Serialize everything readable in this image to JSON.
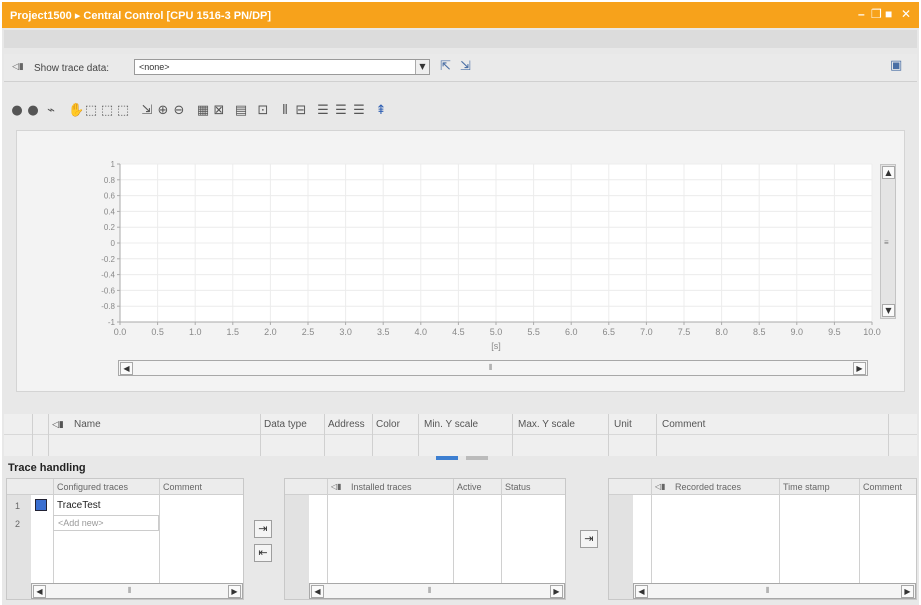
{
  "window": {
    "title": "Project1500 ▸ Central Control [CPU 1516-3 PN/DP]",
    "controls": [
      "–",
      "❐",
      "■",
      "✕"
    ]
  },
  "trace_bar": {
    "label": "Show trace data:",
    "value": "<none>"
  },
  "toolbar": {
    "icons": [
      "play-icon",
      "stop-icon",
      "signal-icon",
      "hand-icon",
      "zoom-box-icon",
      "zoom-x-icon",
      "zoom-y-icon",
      "zoom-fit-icon",
      "zoom-in-icon",
      "zoom-out-icon",
      "export-icon",
      "measure-icon",
      "signal-table-icon",
      "legend-icon",
      "cursor-icon",
      "vertical-cursor-icon",
      "list-icon",
      "align-left-icon",
      "align-right-icon",
      "highlight-icon"
    ]
  },
  "chart_data": {
    "type": "line",
    "title": "",
    "xlabel": "[s]",
    "ylabel": "",
    "xlim": [
      0,
      10
    ],
    "ylim": [
      -1,
      1
    ],
    "x_ticks": [
      "0.0",
      "0.5",
      "1.0",
      "1.5",
      "2.0",
      "2.5",
      "3.0",
      "3.5",
      "4.0",
      "4.5",
      "5.0",
      "5.5",
      "6.0",
      "6.5",
      "7.0",
      "7.5",
      "8.0",
      "8.5",
      "9.0",
      "9.5",
      "10.0"
    ],
    "y_ticks": [
      "1",
      "0.8",
      "0.6",
      "0.4",
      "0.2",
      "0",
      "-0.2",
      "-0.4",
      "-0.6",
      "-0.8",
      "-1"
    ],
    "series": [],
    "grid": true
  },
  "signal_table": {
    "columns": [
      "Name",
      "Data type",
      "Address",
      "Color",
      "Min. Y scale",
      "Max. Y scale",
      "Unit",
      "Comment"
    ]
  },
  "trace_handling": {
    "title": "Trace handling",
    "configured": {
      "columns": [
        "Configured traces",
        "Comment"
      ],
      "rows": [
        {
          "num": "1",
          "name": "TraceTest"
        },
        {
          "num": "2",
          "name": "<Add new>"
        }
      ]
    },
    "installed": {
      "columns": [
        "Installed traces",
        "Active",
        "Status"
      ]
    },
    "recorded": {
      "columns": [
        "Recorded traces",
        "Time stamp",
        "Comment"
      ]
    }
  },
  "colors": {
    "titlebar": "#f7a21b",
    "panel": "#e8e8e8",
    "grid": "#ececec"
  }
}
